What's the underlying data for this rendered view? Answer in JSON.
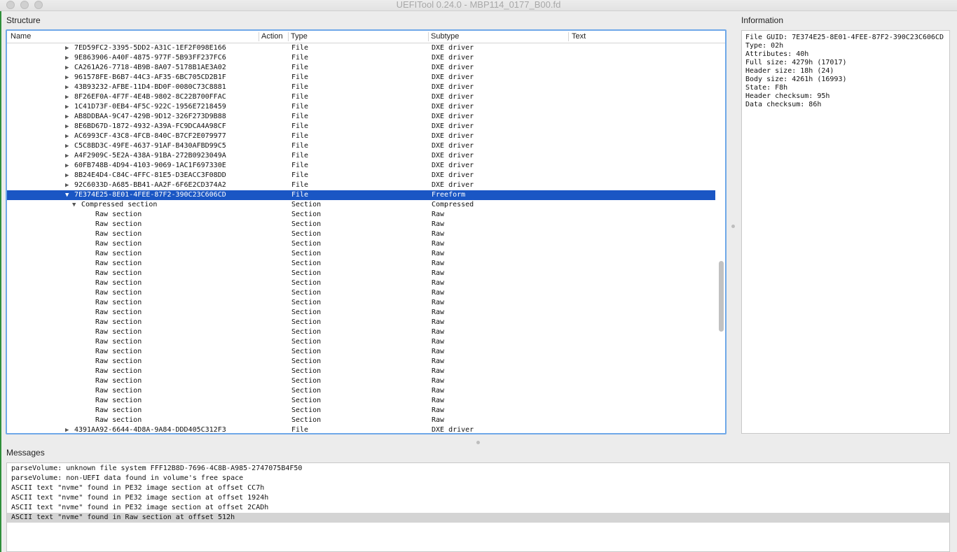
{
  "window": {
    "title": "UEFITool 0.24.0 - MBP114_0177_B00.fd"
  },
  "structure": {
    "label": "Structure",
    "columns": {
      "name": "Name",
      "action": "Action",
      "type": "Type",
      "subtype": "Subtype",
      "text": "Text"
    },
    "rows": [
      {
        "arrow": "▶",
        "name": "7ED59FC2-3395-5DD2-A31C-1EF2F098E166",
        "type": "File",
        "subtype": "DXE driver"
      },
      {
        "arrow": "▶",
        "name": "9E863906-A40F-4875-977F-5B93FF237FC6",
        "type": "File",
        "subtype": "DXE driver"
      },
      {
        "arrow": "▶",
        "name": "CA261A26-7718-4B9B-8A07-5178B1AE3A02",
        "type": "File",
        "subtype": "DXE driver"
      },
      {
        "arrow": "▶",
        "name": "961578FE-B6B7-44C3-AF35-6BC705CD2B1F",
        "type": "File",
        "subtype": "DXE driver"
      },
      {
        "arrow": "▶",
        "name": "43B93232-AFBE-11D4-BD0F-0080C73C8881",
        "type": "File",
        "subtype": "DXE driver"
      },
      {
        "arrow": "▶",
        "name": "8F26EF0A-4F7F-4E4B-9802-8C22B700FFAC",
        "type": "File",
        "subtype": "DXE driver"
      },
      {
        "arrow": "▶",
        "name": "1C41D73F-0EB4-4F5C-922C-1956E7218459",
        "type": "File",
        "subtype": "DXE driver"
      },
      {
        "arrow": "▶",
        "name": "AB8DDBAA-9C47-429B-9D12-326F273D9B88",
        "type": "File",
        "subtype": "DXE driver"
      },
      {
        "arrow": "▶",
        "name": "8E6BD67D-1872-4932-A39A-FC9DCA4A98CF",
        "type": "File",
        "subtype": "DXE driver"
      },
      {
        "arrow": "▶",
        "name": "AC6993CF-43C8-4FCB-840C-B7CF2E079977",
        "type": "File",
        "subtype": "DXE driver"
      },
      {
        "arrow": "▶",
        "name": "C5C8BD3C-49FE-4637-91AF-B430AFBD99C5",
        "type": "File",
        "subtype": "DXE driver"
      },
      {
        "arrow": "▶",
        "name": "A4F2909C-5E2A-438A-91BA-272B0923049A",
        "type": "File",
        "subtype": "DXE driver"
      },
      {
        "arrow": "▶",
        "name": "60FB748B-4D94-4103-9069-1AC1F697330E",
        "type": "File",
        "subtype": "DXE driver"
      },
      {
        "arrow": "▶",
        "name": "8B24E4D4-C84C-4FFC-81E5-D3EACC3F08DD",
        "type": "File",
        "subtype": "DXE driver"
      },
      {
        "arrow": "▶",
        "name": "92C6033D-A685-BB41-AA2F-6F6E2CD374A2",
        "type": "File",
        "subtype": "DXE driver"
      },
      {
        "arrow": "▼",
        "name": "7E374E25-8E01-4FEE-87F2-390C23C606CD",
        "type": "File",
        "subtype": "Freeform",
        "selected": true
      },
      {
        "arrow": "▼",
        "name": "Compressed section",
        "type": "Section",
        "subtype": "Compressed",
        "level": 2
      },
      {
        "arrow": "",
        "name": "Raw section",
        "type": "Section",
        "subtype": "Raw",
        "level": 3
      },
      {
        "arrow": "",
        "name": "Raw section",
        "type": "Section",
        "subtype": "Raw",
        "level": 3
      },
      {
        "arrow": "",
        "name": "Raw section",
        "type": "Section",
        "subtype": "Raw",
        "level": 3
      },
      {
        "arrow": "",
        "name": "Raw section",
        "type": "Section",
        "subtype": "Raw",
        "level": 3
      },
      {
        "arrow": "",
        "name": "Raw section",
        "type": "Section",
        "subtype": "Raw",
        "level": 3
      },
      {
        "arrow": "",
        "name": "Raw section",
        "type": "Section",
        "subtype": "Raw",
        "level": 3
      },
      {
        "arrow": "",
        "name": "Raw section",
        "type": "Section",
        "subtype": "Raw",
        "level": 3
      },
      {
        "arrow": "",
        "name": "Raw section",
        "type": "Section",
        "subtype": "Raw",
        "level": 3
      },
      {
        "arrow": "",
        "name": "Raw section",
        "type": "Section",
        "subtype": "Raw",
        "level": 3
      },
      {
        "arrow": "",
        "name": "Raw section",
        "type": "Section",
        "subtype": "Raw",
        "level": 3
      },
      {
        "arrow": "",
        "name": "Raw section",
        "type": "Section",
        "subtype": "Raw",
        "level": 3
      },
      {
        "arrow": "",
        "name": "Raw section",
        "type": "Section",
        "subtype": "Raw",
        "level": 3
      },
      {
        "arrow": "",
        "name": "Raw section",
        "type": "Section",
        "subtype": "Raw",
        "level": 3
      },
      {
        "arrow": "",
        "name": "Raw section",
        "type": "Section",
        "subtype": "Raw",
        "level": 3
      },
      {
        "arrow": "",
        "name": "Raw section",
        "type": "Section",
        "subtype": "Raw",
        "level": 3
      },
      {
        "arrow": "",
        "name": "Raw section",
        "type": "Section",
        "subtype": "Raw",
        "level": 3
      },
      {
        "arrow": "",
        "name": "Raw section",
        "type": "Section",
        "subtype": "Raw",
        "level": 3
      },
      {
        "arrow": "",
        "name": "Raw section",
        "type": "Section",
        "subtype": "Raw",
        "level": 3
      },
      {
        "arrow": "",
        "name": "Raw section",
        "type": "Section",
        "subtype": "Raw",
        "level": 3
      },
      {
        "arrow": "",
        "name": "Raw section",
        "type": "Section",
        "subtype": "Raw",
        "level": 3
      },
      {
        "arrow": "",
        "name": "Raw section",
        "type": "Section",
        "subtype": "Raw",
        "level": 3
      },
      {
        "arrow": "",
        "name": "Raw section",
        "type": "Section",
        "subtype": "Raw",
        "level": 3
      },
      {
        "arrow": "▶",
        "name": "4391AA92-6644-4D8A-9A84-DDD405C312F3",
        "type": "File",
        "subtype": "DXE driver"
      }
    ]
  },
  "information": {
    "label": "Information",
    "lines": [
      "File GUID: 7E374E25-8E01-4FEE-87F2-390C23C606CD",
      "Type: 02h",
      "Attributes: 40h",
      "Full size: 4279h (17017)",
      "Header size: 18h (24)",
      "Body size: 4261h (16993)",
      "State: F8h",
      "Header checksum: 95h",
      "Data checksum: 86h"
    ]
  },
  "messages": {
    "label": "Messages",
    "items": [
      {
        "text": "parseVolume: unknown file system FFF12B8D-7696-4C8B-A985-2747075B4F50"
      },
      {
        "text": "parseVolume: non-UEFI data found in volume's free space"
      },
      {
        "text": "ASCII text \"nvme\" found in PE32 image section at offset CC7h"
      },
      {
        "text": "ASCII text \"nvme\" found in PE32 image section at offset 1924h"
      },
      {
        "text": "ASCII text \"nvme\" found in PE32 image section at offset 2CADh"
      },
      {
        "text": "ASCII text \"nvme\" found in Raw section at offset 512h",
        "highlighted": true
      }
    ]
  },
  "colors": {
    "selection": "#1a56c4",
    "focus_border": "#6fa8e8",
    "message_highlight": "#d4d4d4"
  }
}
